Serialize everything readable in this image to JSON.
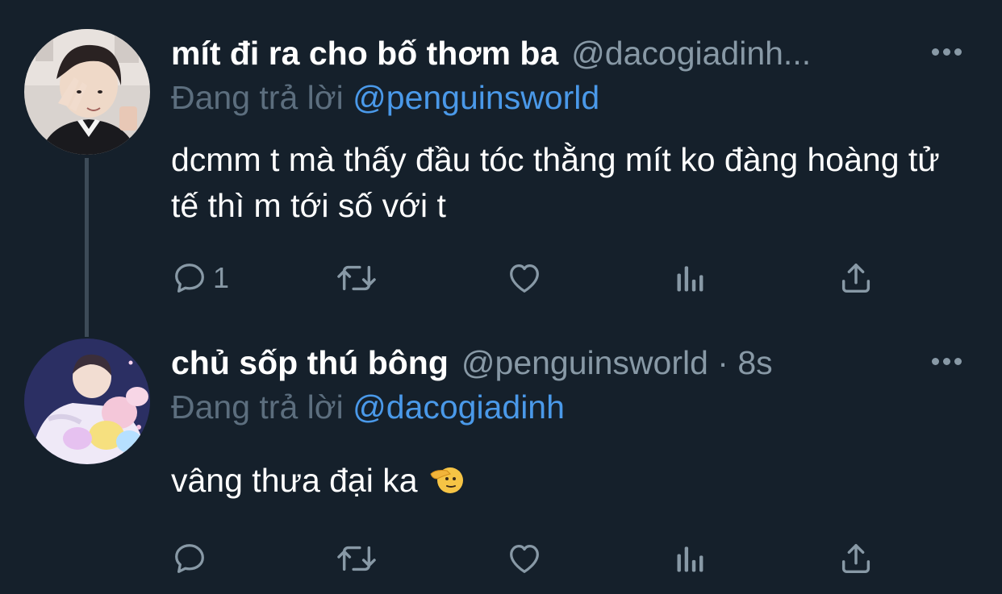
{
  "tweets": [
    {
      "display_name": "mít đi ra cho bố thơm ba",
      "handle": "@dacogiadinh...",
      "reply_prefix": "Đang trả lời",
      "reply_to": "@penguinsworld",
      "text": "dcmm t mà thấy đầu tóc thằng mít ko đàng hoàng tử tế thì m tới số với t",
      "reply_count": "1"
    },
    {
      "display_name": "chủ sốp thú bông",
      "handle": "@penguinsworld · 8s",
      "reply_prefix": "Đang trả lời",
      "reply_to": "@dacogiadinh",
      "text": "vâng thưa đại ka",
      "emoji": "saluting-face-icon"
    }
  ],
  "icons": {
    "reply": "comment-bubble-icon",
    "retweet": "retweet-arrows-icon",
    "like": "heart-icon",
    "views": "bar-chart-icon",
    "share": "share-upload-icon",
    "more": "more-dots-icon"
  },
  "colors": {
    "background": "#15202b",
    "primary_text": "#ffffff",
    "secondary_text": "#8899a6",
    "link": "#4a99e9",
    "thread_line": "#3d4b58"
  }
}
